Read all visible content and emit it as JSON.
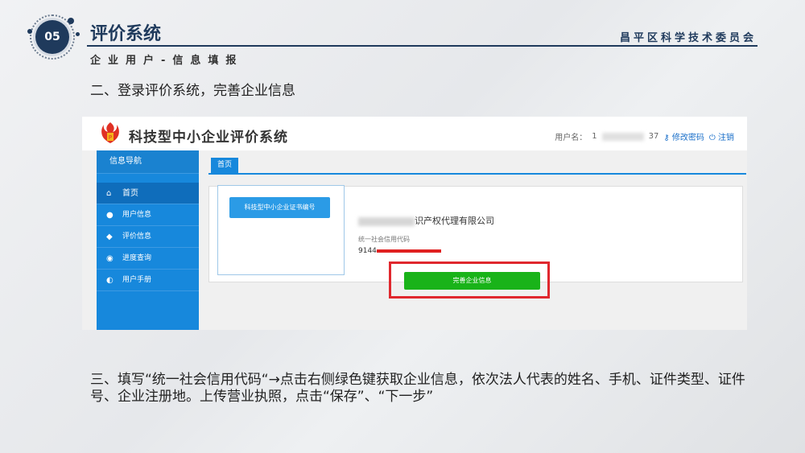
{
  "slide": {
    "number": "05",
    "title": "评价系统",
    "organization": "昌平区科学技术委员会",
    "subtitle": "企业用户-信息填报",
    "step2": "二、登录评价系统，完善企业信息",
    "step3": "三、填写“统一社会信用代码“→点击右侧绿色键获取企业信息，依次法人代表的姓名、手机、证件类型、证件号、企业注册地。上传营业执照，点击“保存”、“下一步”"
  },
  "app": {
    "title": "科技型中小企业评价系统",
    "user_label": "用户名：",
    "user_prefix": "1",
    "user_suffix": "37",
    "change_password": "修改密码",
    "logout": "注销"
  },
  "sidebar": {
    "heading": "信息导航",
    "items": [
      {
        "label": "首页",
        "icon": "home-icon",
        "active": true
      },
      {
        "label": "用户信息",
        "icon": "user-icon",
        "active": false
      },
      {
        "label": "评价信息",
        "icon": "tag-icon",
        "active": false
      },
      {
        "label": "进度查询",
        "icon": "eye-icon",
        "active": false
      },
      {
        "label": "用户手册",
        "icon": "book-icon",
        "active": false
      }
    ]
  },
  "main": {
    "tab": "首页",
    "cert_button": "科技型中小企业证书编号",
    "company_suffix": "识产权代理有限公司",
    "credit_label": "统一社会信用代码",
    "credit_prefix": "9144",
    "complete_button": "完善企业信息"
  },
  "colors": {
    "navy": "#1f3a5c",
    "sidebar": "#1788dc",
    "green_button": "#19b319",
    "highlight": "#e0282e"
  }
}
